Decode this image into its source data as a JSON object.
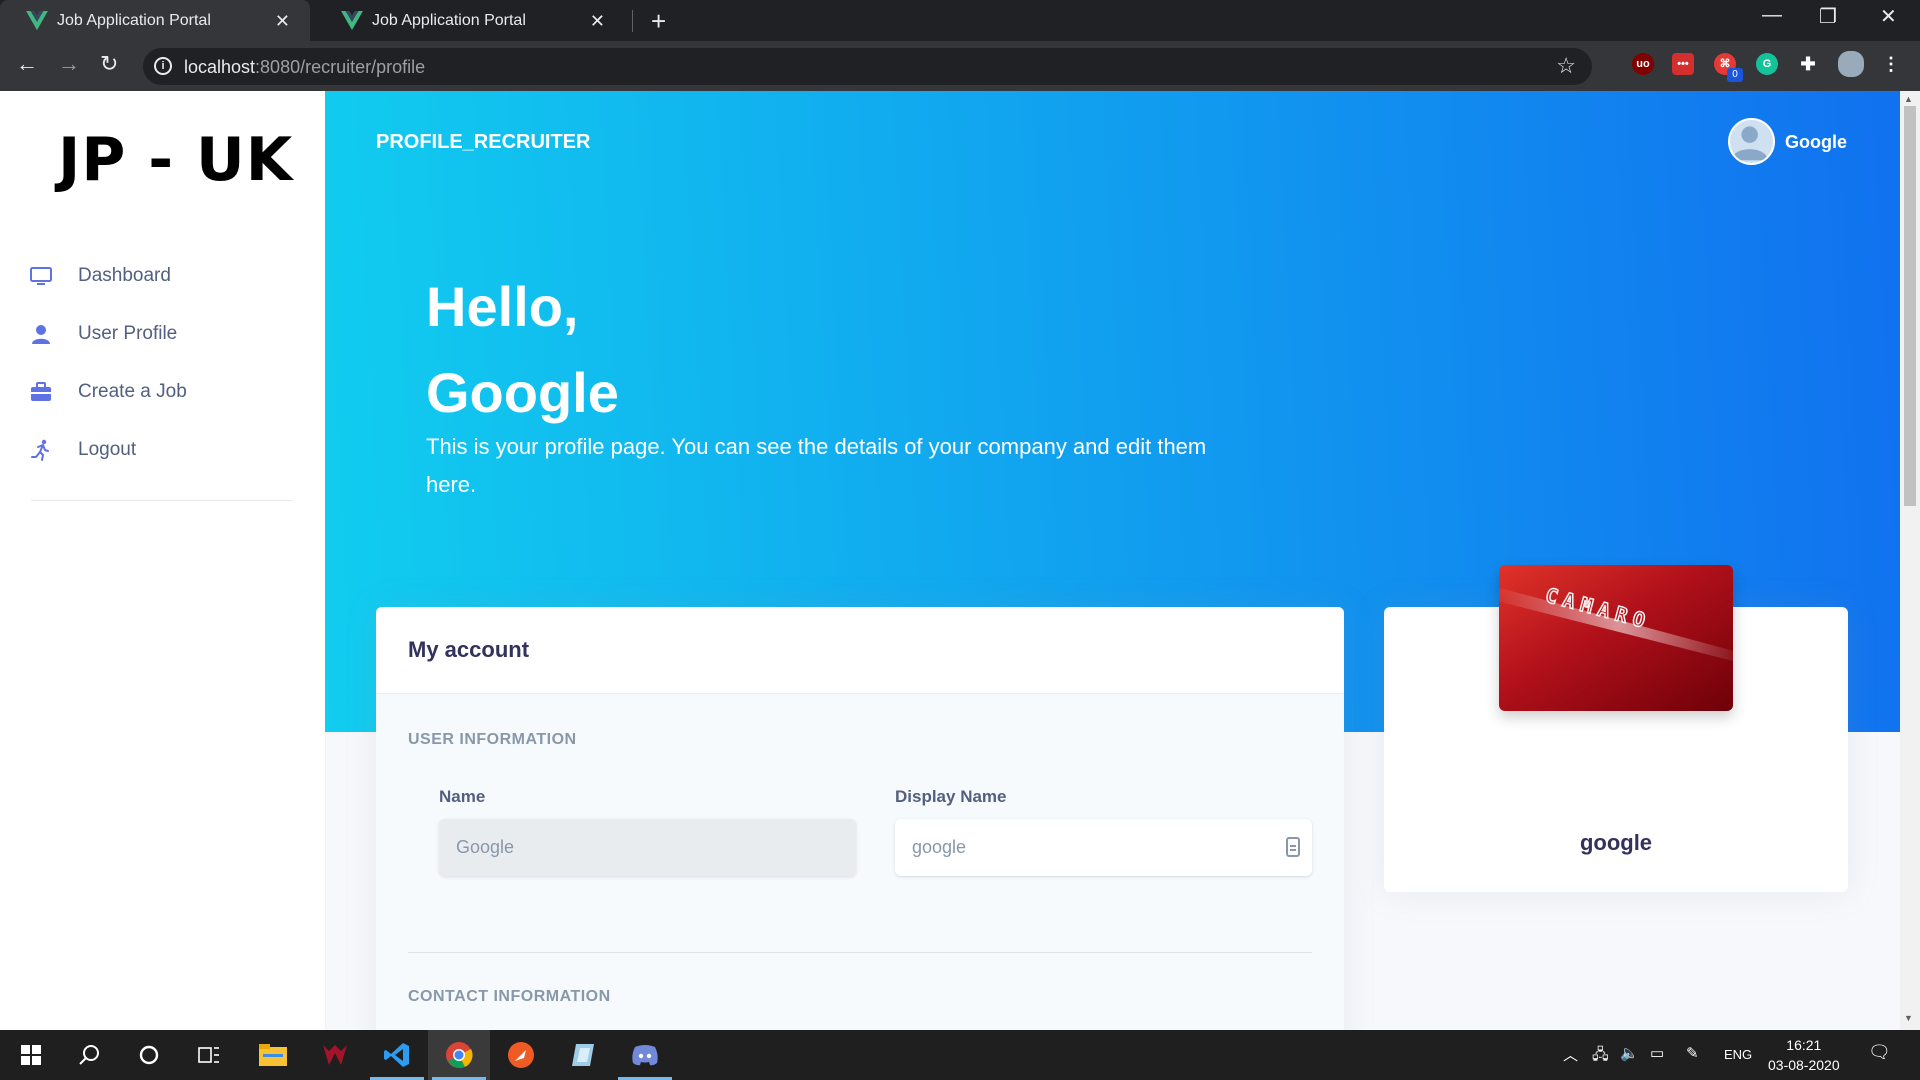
{
  "browser": {
    "tabs": [
      {
        "title": "Job Application Portal",
        "active": true
      },
      {
        "title": "Job Application Portal",
        "active": false
      }
    ],
    "new_tab": "+",
    "url_host": "localhost",
    "url_path": ":8080/recruiter/profile",
    "window_controls": {
      "minimize": "—",
      "restore": "❐",
      "close": "✕"
    },
    "ext_badge": "0"
  },
  "sidebar": {
    "brand": "JP - UK",
    "items": [
      {
        "label": "Dashboard",
        "icon": "monitor-icon"
      },
      {
        "label": "User Profile",
        "icon": "user-icon"
      },
      {
        "label": "Create a Job",
        "icon": "briefcase-icon"
      },
      {
        "label": "Logout",
        "icon": "running-person-icon"
      }
    ]
  },
  "header": {
    "title": "PROFILE_RECRUITER",
    "user_name": "Google"
  },
  "hero": {
    "greeting_line1": "Hello,",
    "greeting_line2": "Google",
    "description": "This is your profile page. You can see the details of your company and edit them here."
  },
  "account": {
    "title": "My account",
    "user_info_heading": "USER INFORMATION",
    "name_label": "Name",
    "name_value": "Google",
    "display_name_label": "Display Name",
    "display_name_value": "google",
    "contact_heading": "CONTACT INFORMATION"
  },
  "profile_card": {
    "image_text": "CAMARO",
    "name": "google"
  },
  "taskbar": {
    "language": "ENG",
    "time": "16:21",
    "date": "03-08-2020"
  },
  "colors": {
    "hero_start": "#11cdef",
    "hero_end": "#1171ef",
    "nav_icon": "#5e72e4",
    "heading_text": "#32325d"
  }
}
